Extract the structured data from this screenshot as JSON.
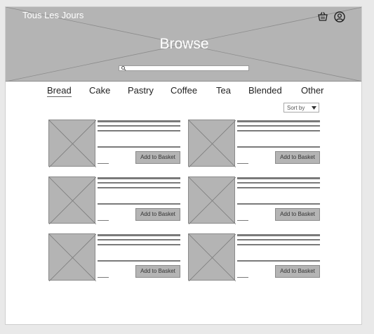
{
  "header": {
    "brand": "Tous Les Jours",
    "title": "Browse",
    "search_placeholder": "",
    "icons": [
      "basket-icon",
      "account-icon",
      "search-icon"
    ]
  },
  "tabs": [
    {
      "label": "Bread",
      "active": true
    },
    {
      "label": "Cake",
      "active": false
    },
    {
      "label": "Pastry",
      "active": false
    },
    {
      "label": "Coffee",
      "active": false
    },
    {
      "label": "Tea",
      "active": false
    },
    {
      "label": "Blended",
      "active": false
    },
    {
      "label": "Other",
      "active": false
    }
  ],
  "sort": {
    "label": "Sort by"
  },
  "products": [
    {
      "button_label": "Add to Basket"
    },
    {
      "button_label": "Add to Basket"
    },
    {
      "button_label": "Add to Basket"
    },
    {
      "button_label": "Add to Basket"
    },
    {
      "button_label": "Add to Basket"
    },
    {
      "button_label": "Add to Basket"
    }
  ],
  "colors": {
    "placeholder_fill": "#b4b4b4",
    "line": "#7a7a7a",
    "page_bg": "#ffffff",
    "outer_bg": "#e9e9e9"
  }
}
